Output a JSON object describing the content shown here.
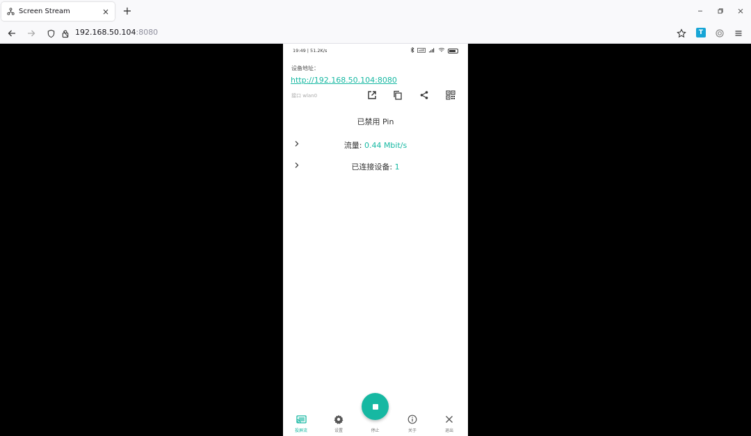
{
  "browser": {
    "tab_title": "Screen Stream",
    "tab_close": "×",
    "new_tab": "+",
    "url_host": "192.168.50.104",
    "url_port": ":8080",
    "extension_label": "T"
  },
  "phone": {
    "status_left": "19:49 | 51.2K/s",
    "address_label": "设备地址：",
    "address_link": "http://192.168.50.104:8080",
    "interface_label": "接口  wlan0",
    "pin_status": "已禁用 Pin",
    "traffic_label": "流量: ",
    "traffic_value": "0.44 Mbit/s",
    "devices_label": "已连接设备: ",
    "devices_value": "1",
    "nav": {
      "stream": "投屏流",
      "settings": "设置",
      "stop": "停止",
      "about": "关于",
      "exit": "退出"
    }
  },
  "colors": {
    "accent": "#16b8a2"
  }
}
